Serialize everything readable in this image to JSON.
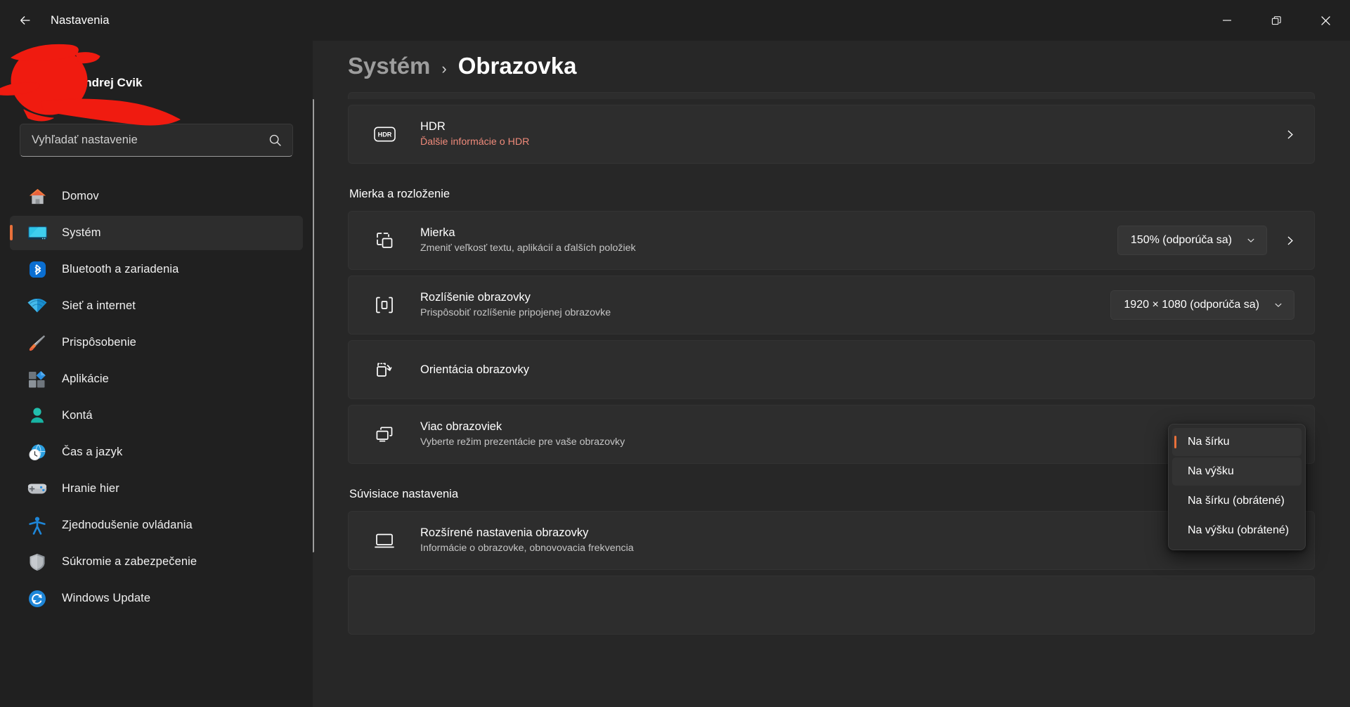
{
  "window": {
    "title": "Nastavenia",
    "back_icon": "arrow-left-icon",
    "controls": {
      "minimize": "minimize-icon",
      "restore": "restore-icon",
      "close": "close-icon"
    }
  },
  "account": {
    "name": "Andrej Cvik",
    "redacted": true,
    "redaction_color": "#f01b10"
  },
  "search": {
    "placeholder": "Vyhľadať nastavenie",
    "value": "",
    "icon": "search-icon"
  },
  "sidebar": {
    "items": [
      {
        "label": "Domov",
        "icon": "home-icon",
        "selected": false
      },
      {
        "label": "Systém",
        "icon": "monitor-icon",
        "selected": true
      },
      {
        "label": "Bluetooth a zariadenia",
        "icon": "bluetooth-icon",
        "selected": false
      },
      {
        "label": "Sieť a internet",
        "icon": "wifi-icon",
        "selected": false
      },
      {
        "label": "Prispôsobenie",
        "icon": "paintbrush-icon",
        "selected": false
      },
      {
        "label": "Aplikácie",
        "icon": "apps-icon",
        "selected": false
      },
      {
        "label": "Kontá",
        "icon": "person-icon",
        "selected": false
      },
      {
        "label": "Čas a jazyk",
        "icon": "clock-globe-icon",
        "selected": false
      },
      {
        "label": "Hranie hier",
        "icon": "gamepad-icon",
        "selected": false
      },
      {
        "label": "Zjednodušenie ovládania",
        "icon": "accessibility-icon",
        "selected": false
      },
      {
        "label": "Súkromie a zabezpečenie",
        "icon": "shield-icon",
        "selected": false
      },
      {
        "label": "Windows Update",
        "icon": "update-icon",
        "selected": false
      }
    ],
    "accent_color": "#e8703a"
  },
  "breadcrumb": {
    "parent": "Systém",
    "separator": "›",
    "current": "Obrazovka"
  },
  "main": {
    "hdr_card": {
      "title": "HDR",
      "subtitle": "Ďalšie informácie o HDR",
      "subtitle_color": "#ef8a7a",
      "icon": "hdr-icon",
      "chevron": "chevron-right-icon"
    },
    "section_scale": {
      "heading": "Mierka a rozloženie",
      "cards": [
        {
          "title": "Mierka",
          "subtitle": "Zmeniť veľkosť textu, aplikácií a ďalších položiek",
          "icon": "scale-icon",
          "combo_value": "150% (odporúča sa)",
          "has_chevron": true
        },
        {
          "title": "Rozlíšenie obrazovky",
          "subtitle": "Prispôsobiť rozlíšenie pripojenej obrazovke",
          "icon": "resolution-icon",
          "combo_value": "1920 × 1080 (odporúča sa)",
          "has_chevron": false
        },
        {
          "title": "Orientácia obrazovky",
          "subtitle": "",
          "icon": "orientation-icon",
          "combo_value": "",
          "has_chevron": false
        },
        {
          "title": "Viac obrazoviek",
          "subtitle": "Vyberte režim prezentácie pre vaše obrazovky",
          "icon": "multi-display-icon",
          "combo_value": "",
          "has_chevron": false
        }
      ]
    },
    "section_related": {
      "heading": "Súvisiace nastavenia",
      "cards": [
        {
          "title": "Rozšírené nastavenia obrazovky",
          "subtitle": "Informácie o obrazovke, obnovovacia frekvencia",
          "icon": "display-icon",
          "chevron": "chevron-right-icon"
        }
      ]
    }
  },
  "orientation_flyout": {
    "open": true,
    "items": [
      {
        "label": "Na šírku",
        "selected": true,
        "hovered": false
      },
      {
        "label": "Na výšku",
        "selected": false,
        "hovered": true
      },
      {
        "label": "Na šírku (obrátené)",
        "selected": false,
        "hovered": false
      },
      {
        "label": "Na výšku (obrátené)",
        "selected": false,
        "hovered": false
      }
    ]
  }
}
